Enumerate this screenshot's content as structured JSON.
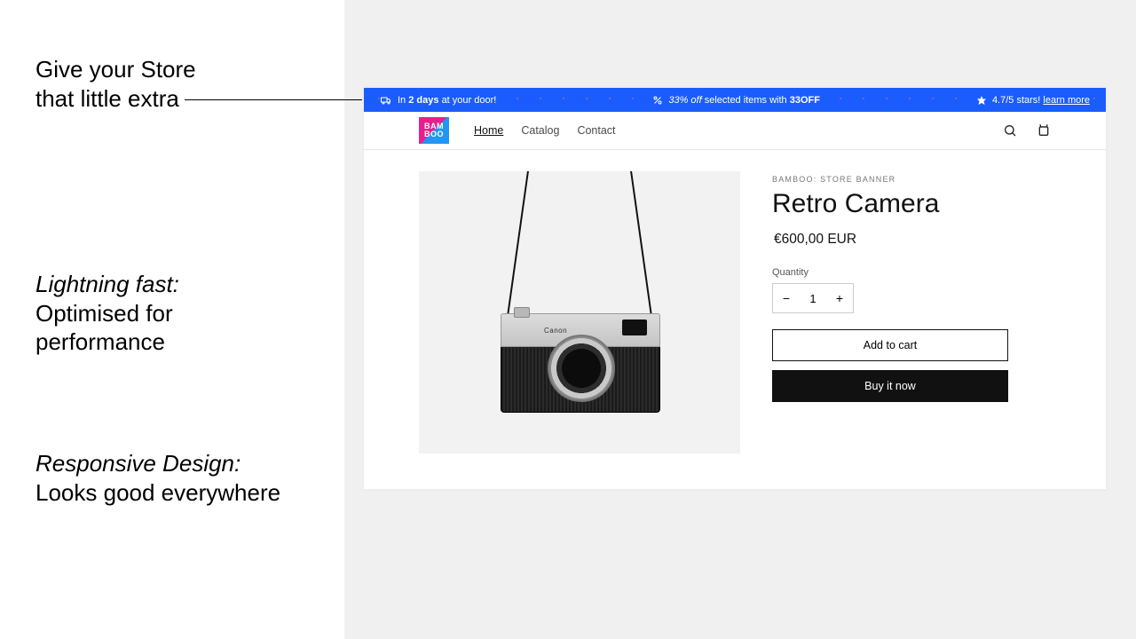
{
  "marketing": {
    "feature1_l1": "Give your Store",
    "feature1_l2": "that little extra",
    "feature2_title": "Lightning fast:",
    "feature2_l1": "Optimised for",
    "feature2_l2": "performance",
    "feature3_title": "Responsive Design:",
    "feature3_l1": "Looks good everywhere"
  },
  "banner": {
    "seg1_pre": "In",
    "seg1_bold": "2 days",
    "seg1_post": "at your door!",
    "seg2_pre": "33% off",
    "seg2_mid": "selected items with",
    "seg2_code": "33OFF",
    "seg3_pre": "4.7/5 stars!",
    "seg3_link": "learn more"
  },
  "logo": {
    "l1": "BAM",
    "l2": "BOO"
  },
  "nav": {
    "home": "Home",
    "catalog": "Catalog",
    "contact": "Contact"
  },
  "product": {
    "vendor": "BAMBOO: STORE BANNER",
    "title": "Retro Camera",
    "price": "€600,00 EUR",
    "qty_label": "Quantity",
    "qty_value": "1",
    "add": "Add to cart",
    "buy": "Buy it now",
    "camera_brand": "Canon"
  }
}
